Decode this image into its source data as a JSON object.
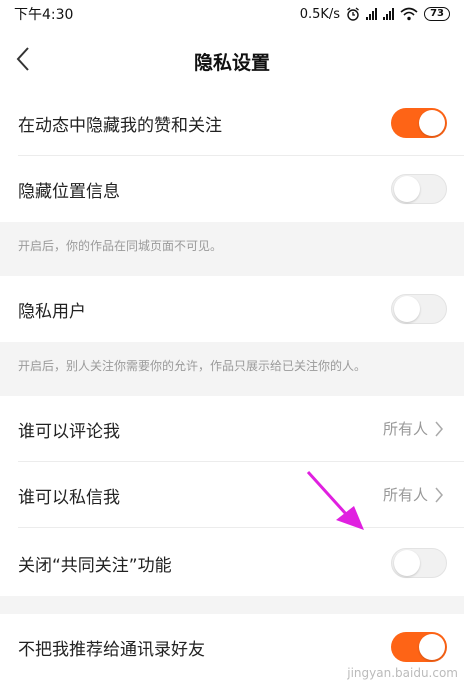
{
  "status_bar": {
    "time": "下午4:30",
    "network_speed": "0.5K/s",
    "battery": "73"
  },
  "header": {
    "title": "隐私设置",
    "back_icon": "chevron-left-icon"
  },
  "settings": [
    {
      "label": "在动态中隐藏我的赞和关注",
      "toggle": "on"
    },
    {
      "label": "隐藏位置信息",
      "toggle": "off"
    },
    {
      "label": "隐私用户",
      "toggle": "off"
    },
    {
      "label": "谁可以评论我",
      "value": "所有人"
    },
    {
      "label": "谁可以私信我",
      "value": "所有人"
    },
    {
      "label": "关闭“共同关注”功能",
      "toggle": "off"
    },
    {
      "label": "不把我推荐给通讯录好友",
      "toggle": "on"
    }
  ],
  "notes": {
    "location": "开启后，你的作品在同城页面不可见。",
    "private": "开启后，别人关注你需要你的允许，作品只展示给已关注你的人。"
  },
  "colors": {
    "accent": "#fe6416",
    "annotation_arrow": "#e020e0",
    "section_bg": "#f4f4f4"
  },
  "watermark": "jingyan.baidu.com"
}
